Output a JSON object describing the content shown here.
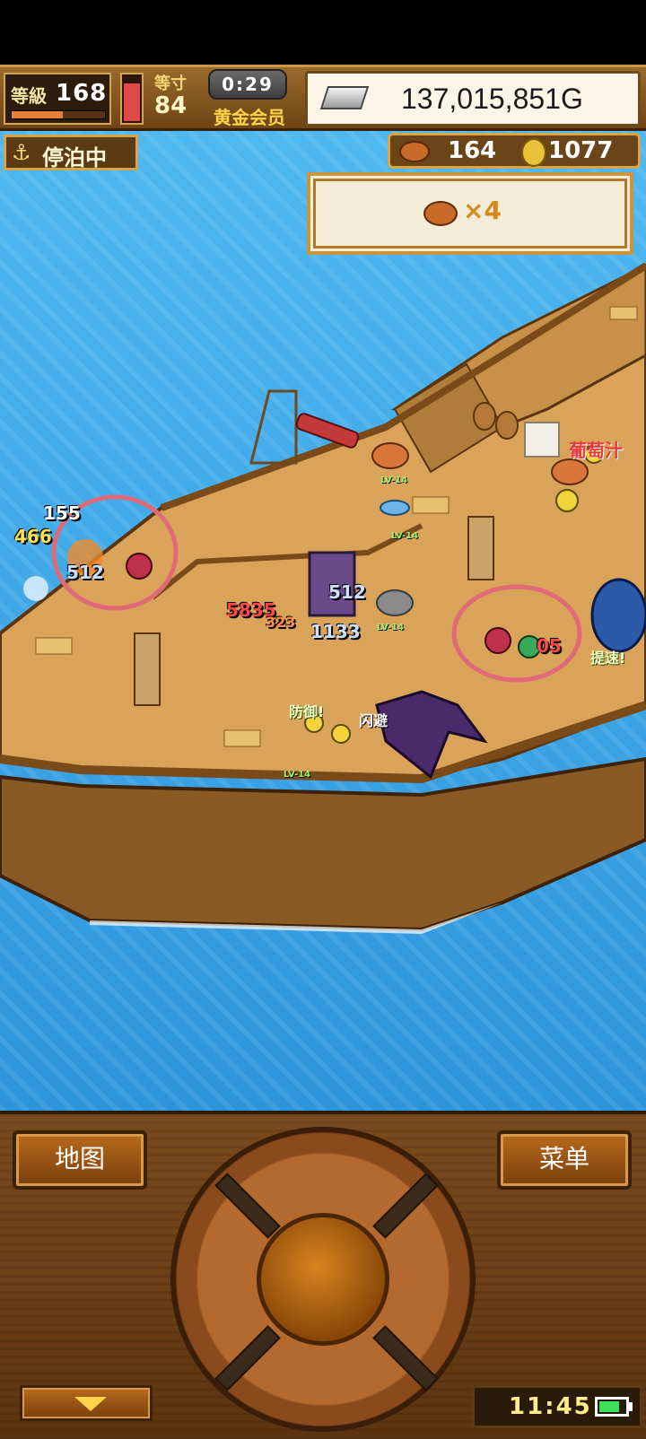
{
  "header": {
    "level_label": "等級",
    "level_value": "168",
    "exp_progress": 0.55,
    "stamina_fill": 0.85,
    "rank_label": "等寸",
    "rank_value": "84",
    "timer": "0:29",
    "membership": "黄金会员",
    "gold": "137,015,851G"
  },
  "status": {
    "docked_icon": "⚓",
    "docked_label": "停泊中",
    "meat_count": "164",
    "coin_count": "1077"
  },
  "item_panel": {
    "count_label": "×4"
  },
  "scene": {
    "grape_juice_label": "葡萄汁",
    "dodge_label": "闪避",
    "defend_label": "防御!",
    "haste_label": "提速!",
    "popups": [
      "155",
      "466",
      "512",
      "5835",
      "323",
      "512",
      "1133",
      "05"
    ],
    "lv_tags": [
      "LV-14",
      "LV-14",
      "LV-14",
      "LV-14"
    ]
  },
  "controls": {
    "map_label": "地图",
    "menu_label": "菜单"
  },
  "system": {
    "clock": "11:45",
    "battery_level": 0.8
  },
  "colors": {
    "sea": "#3aa6e8",
    "deck": "#d9a35a",
    "panel_wood": "#6b3f14",
    "highlight_circle": "#e06a78"
  }
}
